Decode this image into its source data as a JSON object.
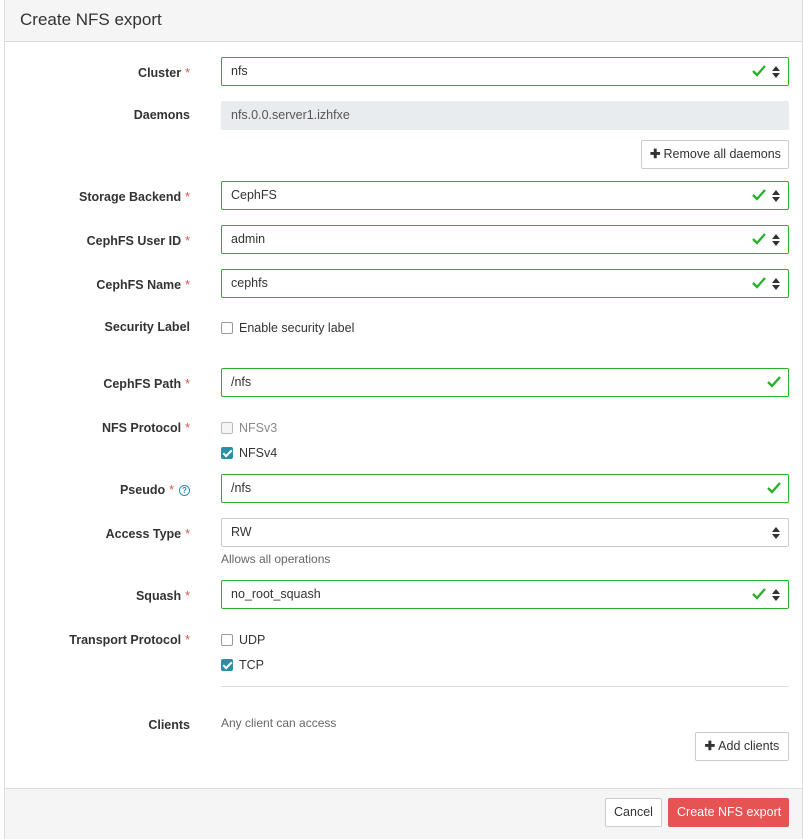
{
  "title": "Create NFS export",
  "form": {
    "cluster": {
      "label": "Cluster",
      "value": "nfs"
    },
    "daemons": {
      "label": "Daemons",
      "value": "nfs.0.0.server1.izhfxe",
      "remove_label": "Remove all daemons"
    },
    "storage_backend": {
      "label": "Storage Backend",
      "value": "CephFS"
    },
    "cephfs_user_id": {
      "label": "CephFS User ID",
      "value": "admin"
    },
    "cephfs_name": {
      "label": "CephFS Name",
      "value": "cephfs"
    },
    "security_label": {
      "label": "Security Label",
      "checkbox_label": "Enable security label",
      "checked": false
    },
    "cephfs_path": {
      "label": "CephFS Path",
      "value": "/nfs"
    },
    "nfs_protocol": {
      "label": "NFS Protocol",
      "options": [
        {
          "label": "NFSv3",
          "checked": false,
          "disabled": true
        },
        {
          "label": "NFSv4",
          "checked": true
        }
      ]
    },
    "pseudo": {
      "label": "Pseudo",
      "value": "/nfs",
      "help_icon": "question-circle-icon"
    },
    "access_type": {
      "label": "Access Type",
      "value": "RW",
      "help": "Allows all operations"
    },
    "squash": {
      "label": "Squash",
      "value": "no_root_squash"
    },
    "transport_protocol": {
      "label": "Transport Protocol",
      "options": [
        {
          "label": "UDP",
          "checked": false
        },
        {
          "label": "TCP",
          "checked": true
        }
      ]
    },
    "clients": {
      "label": "Clients",
      "text": "Any client can access",
      "add_label": "Add clients"
    },
    "required_mark": "*"
  },
  "footer": {
    "cancel_label": "Cancel",
    "submit_label": "Create NFS export"
  },
  "colors": {
    "valid": "#2bb02b",
    "primary": "#e55353",
    "checkbox": "#2b8fa6",
    "required": "#d9534f"
  }
}
